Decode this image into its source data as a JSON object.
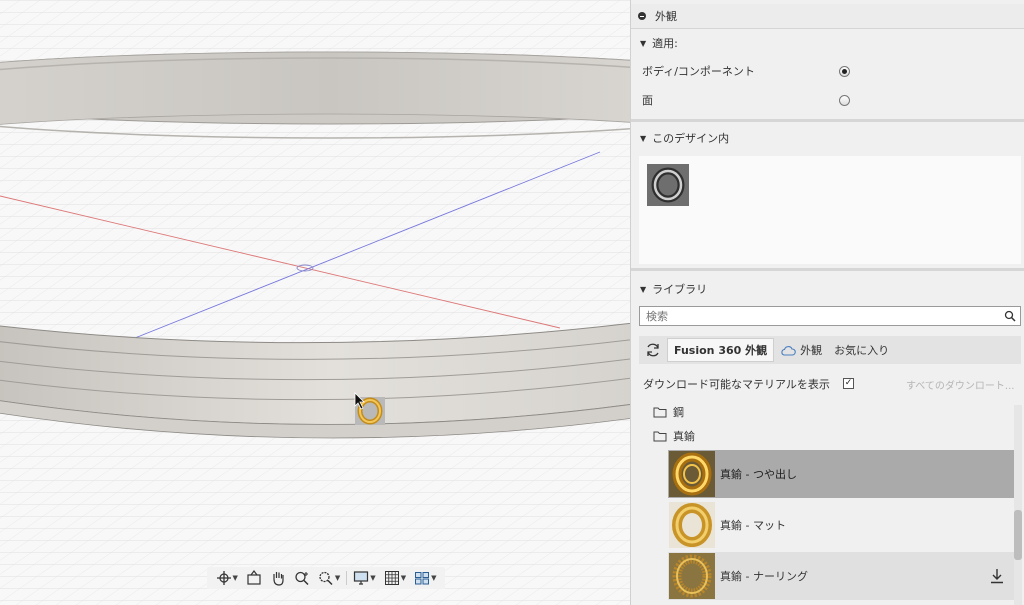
{
  "panel": {
    "title": "外観",
    "apply": {
      "heading": "適用:",
      "options": [
        {
          "label": "ボディ/コンポーネント",
          "selected": true
        },
        {
          "label": "面",
          "selected": false
        }
      ]
    },
    "in_design": {
      "heading": "このデザイン内"
    },
    "library": {
      "heading": "ライブラリ",
      "search_placeholder": "検索",
      "tabs": [
        {
          "label": "Fusion 360 外観",
          "active": true
        },
        {
          "label": "外観",
          "icon": "cloud-icon"
        },
        {
          "label": "お気に入り"
        }
      ],
      "show_downloadable_label": "ダウンロード可能なマテリアルを表示",
      "show_downloadable_checked": true,
      "download_all_link": "すべてのダウンロート...",
      "folders": [
        {
          "label": "鋼"
        },
        {
          "label": "真鍮"
        }
      ],
      "materials": [
        {
          "label": "真鍮 - つや出し",
          "state": "selected"
        },
        {
          "label": "真鍮 - マット",
          "state": "normal"
        },
        {
          "label": "真鍮 - ナーリング",
          "state": "hover",
          "download_icon": "download-icon"
        }
      ]
    }
  },
  "toolbar": {
    "tools": [
      "orbit-icon",
      "look-at-icon",
      "pan-icon",
      "zoom-icon",
      "fit-icon",
      "display-settings-icon",
      "grid-icon",
      "viewports-icon"
    ]
  },
  "colors": {
    "panel_bg": "#f0f0f0",
    "selected_row": "#aaaaaa",
    "brass": "#d8a93a"
  }
}
